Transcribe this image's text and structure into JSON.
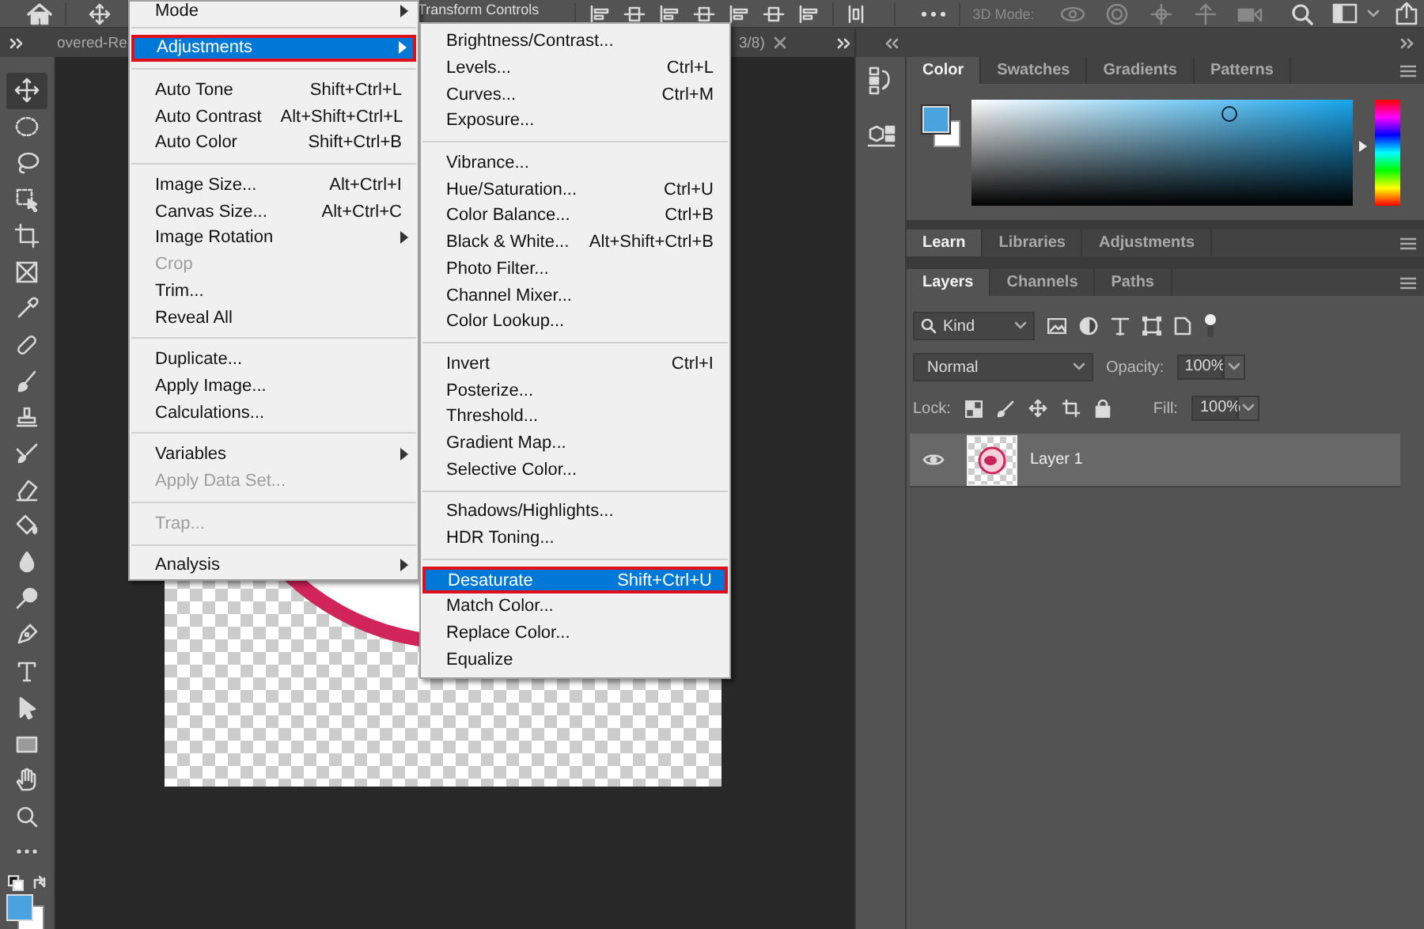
{
  "options_bar": {
    "transform_label": "Transform Controls",
    "mode_label": "3D Mode:"
  },
  "document_tab": {
    "title_start": "overed-Re",
    "title_end": "3/8)"
  },
  "toolbar": {
    "tools": [
      {
        "kind": "move",
        "selected": true
      },
      {
        "kind": "marquee",
        "selected": false
      },
      {
        "kind": "lasso",
        "selected": false
      },
      {
        "kind": "object-select",
        "selected": false
      },
      {
        "kind": "crop",
        "selected": false
      },
      {
        "kind": "frame",
        "selected": false
      },
      {
        "kind": "eyedropper",
        "selected": false
      },
      {
        "kind": "bandage",
        "selected": false
      },
      {
        "kind": "brush",
        "selected": false
      },
      {
        "kind": "stamp",
        "selected": false
      },
      {
        "kind": "mixer-brush",
        "selected": false
      },
      {
        "kind": "eraser",
        "selected": false
      },
      {
        "kind": "bucket",
        "selected": false
      },
      {
        "kind": "drop",
        "selected": false
      },
      {
        "kind": "dodge",
        "selected": false
      },
      {
        "kind": "pen",
        "selected": false
      },
      {
        "kind": "type",
        "selected": false
      },
      {
        "kind": "path-select",
        "selected": false
      },
      {
        "kind": "rectangle",
        "selected": false
      },
      {
        "kind": "hand",
        "selected": false
      },
      {
        "kind": "zoom",
        "selected": false
      },
      {
        "kind": "more",
        "selected": false
      }
    ]
  },
  "image_menu": {
    "items": [
      {
        "kind": "item",
        "label": "Mode",
        "submenu": true,
        "disabled": false,
        "selected": false
      },
      {
        "kind": "separator"
      },
      {
        "kind": "item",
        "label": "Adjustments",
        "submenu": true,
        "disabled": false,
        "selected": true
      },
      {
        "kind": "separator"
      },
      {
        "kind": "item",
        "label": "Auto Tone",
        "shortcut": "Shift+Ctrl+L",
        "submenu": false,
        "disabled": false,
        "selected": false
      },
      {
        "kind": "item",
        "label": "Auto Contrast",
        "shortcut": "Alt+Shift+Ctrl+L",
        "submenu": false,
        "disabled": false,
        "selected": false
      },
      {
        "kind": "item",
        "label": "Auto Color",
        "shortcut": "Shift+Ctrl+B",
        "submenu": false,
        "disabled": false,
        "selected": false
      },
      {
        "kind": "separator"
      },
      {
        "kind": "item",
        "label": "Image Size...",
        "shortcut": "Alt+Ctrl+I",
        "submenu": false,
        "disabled": false,
        "selected": false
      },
      {
        "kind": "item",
        "label": "Canvas Size...",
        "shortcut": "Alt+Ctrl+C",
        "submenu": false,
        "disabled": false,
        "selected": false
      },
      {
        "kind": "item",
        "label": "Image Rotation",
        "submenu": true,
        "disabled": false,
        "selected": false
      },
      {
        "kind": "item",
        "label": "Crop",
        "submenu": false,
        "disabled": true,
        "selected": false
      },
      {
        "kind": "item",
        "label": "Trim...",
        "submenu": false,
        "disabled": false,
        "selected": false
      },
      {
        "kind": "item",
        "label": "Reveal All",
        "submenu": false,
        "disabled": false,
        "selected": false
      },
      {
        "kind": "separator"
      },
      {
        "kind": "item",
        "label": "Duplicate...",
        "submenu": false,
        "disabled": false,
        "selected": false
      },
      {
        "kind": "item",
        "label": "Apply Image...",
        "submenu": false,
        "disabled": false,
        "selected": false
      },
      {
        "kind": "item",
        "label": "Calculations...",
        "submenu": false,
        "disabled": false,
        "selected": false
      },
      {
        "kind": "separator"
      },
      {
        "kind": "item",
        "label": "Variables",
        "submenu": true,
        "disabled": false,
        "selected": false
      },
      {
        "kind": "item",
        "label": "Apply Data Set...",
        "submenu": false,
        "disabled": true,
        "selected": false
      },
      {
        "kind": "separator"
      },
      {
        "kind": "item",
        "label": "Trap...",
        "submenu": false,
        "disabled": true,
        "selected": false
      },
      {
        "kind": "separator"
      },
      {
        "kind": "item",
        "label": "Analysis",
        "submenu": true,
        "disabled": false,
        "selected": false
      }
    ]
  },
  "adjustments_menu": {
    "items": [
      {
        "kind": "item",
        "label": "Brightness/Contrast...",
        "submenu": false,
        "disabled": false,
        "selected": false
      },
      {
        "kind": "item",
        "label": "Levels...",
        "shortcut": "Ctrl+L",
        "submenu": false,
        "disabled": false,
        "selected": false
      },
      {
        "kind": "item",
        "label": "Curves...",
        "shortcut": "Ctrl+M",
        "submenu": false,
        "disabled": false,
        "selected": false
      },
      {
        "kind": "item",
        "label": "Exposure...",
        "submenu": false,
        "disabled": false,
        "selected": false
      },
      {
        "kind": "separator"
      },
      {
        "kind": "item",
        "label": "Vibrance...",
        "submenu": false,
        "disabled": false,
        "selected": false
      },
      {
        "kind": "item",
        "label": "Hue/Saturation...",
        "shortcut": "Ctrl+U",
        "submenu": false,
        "disabled": false,
        "selected": false
      },
      {
        "kind": "item",
        "label": "Color Balance...",
        "shortcut": "Ctrl+B",
        "submenu": false,
        "disabled": false,
        "selected": false
      },
      {
        "kind": "item",
        "label": "Black & White...",
        "shortcut": "Alt+Shift+Ctrl+B",
        "submenu": false,
        "disabled": false,
        "selected": false
      },
      {
        "kind": "item",
        "label": "Photo Filter...",
        "submenu": false,
        "disabled": false,
        "selected": false
      },
      {
        "kind": "item",
        "label": "Channel Mixer...",
        "submenu": false,
        "disabled": false,
        "selected": false
      },
      {
        "kind": "item",
        "label": "Color Lookup...",
        "submenu": false,
        "disabled": false,
        "selected": false
      },
      {
        "kind": "separator"
      },
      {
        "kind": "item",
        "label": "Invert",
        "shortcut": "Ctrl+I",
        "submenu": false,
        "disabled": false,
        "selected": false
      },
      {
        "kind": "item",
        "label": "Posterize...",
        "submenu": false,
        "disabled": false,
        "selected": false
      },
      {
        "kind": "item",
        "label": "Threshold...",
        "submenu": false,
        "disabled": false,
        "selected": false
      },
      {
        "kind": "item",
        "label": "Gradient Map...",
        "submenu": false,
        "disabled": false,
        "selected": false
      },
      {
        "kind": "item",
        "label": "Selective Color...",
        "submenu": false,
        "disabled": false,
        "selected": false
      },
      {
        "kind": "separator"
      },
      {
        "kind": "item",
        "label": "Shadows/Highlights...",
        "submenu": false,
        "disabled": false,
        "selected": false
      },
      {
        "kind": "item",
        "label": "HDR Toning...",
        "submenu": false,
        "disabled": false,
        "selected": false
      },
      {
        "kind": "separator"
      },
      {
        "kind": "item",
        "label": "Desaturate",
        "shortcut": "Shift+Ctrl+U",
        "submenu": false,
        "disabled": false,
        "selected": true
      },
      {
        "kind": "item",
        "label": "Match Color...",
        "submenu": false,
        "disabled": false,
        "selected": false
      },
      {
        "kind": "item",
        "label": "Replace Color...",
        "submenu": false,
        "disabled": false,
        "selected": false
      },
      {
        "kind": "item",
        "label": "Equalize",
        "submenu": false,
        "disabled": false,
        "selected": false
      }
    ]
  },
  "color_panel": {
    "tabs": [
      {
        "label": "Color",
        "selected": true
      },
      {
        "label": "Swatches",
        "selected": false
      },
      {
        "label": "Gradients",
        "selected": false
      },
      {
        "label": "Patterns",
        "selected": false
      }
    ],
    "hue_slider": {
      "level": 0.57
    }
  },
  "learn_panel": {
    "tabs": [
      {
        "label": "Learn",
        "selected": true
      },
      {
        "label": "Libraries",
        "selected": false
      },
      {
        "label": "Adjustments",
        "selected": false
      }
    ]
  },
  "layers_panel": {
    "tabs": [
      {
        "label": "Layers",
        "selected": true
      },
      {
        "label": "Channels",
        "selected": false
      },
      {
        "label": "Paths",
        "selected": false
      }
    ],
    "filter": {
      "value": "Kind"
    },
    "blend_mode": {
      "value": "Normal"
    },
    "opacity": {
      "label": "Opacity:",
      "value": "100%"
    },
    "lock": {
      "label": "Lock:"
    },
    "fill": {
      "label": "Fill:",
      "value": "100%"
    },
    "layers": [
      {
        "name": "Layer 1",
        "visible": true,
        "selected": true
      }
    ]
  }
}
